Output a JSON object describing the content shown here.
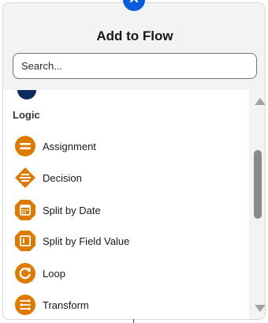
{
  "dialog": {
    "title": "Add to Flow",
    "search_placeholder": "Search...",
    "close_icon": "close-icon"
  },
  "section": {
    "label": "Logic"
  },
  "items": [
    {
      "label": "Assignment",
      "icon": "assignment-icon"
    },
    {
      "label": "Decision",
      "icon": "decision-icon"
    },
    {
      "label": "Split by Date",
      "icon": "split-by-date-icon"
    },
    {
      "label": "Split by Field Value",
      "icon": "split-by-field-value-icon"
    },
    {
      "label": "Loop",
      "icon": "loop-icon"
    },
    {
      "label": "Transform",
      "icon": "transform-icon"
    }
  ],
  "colors": {
    "accent": "#0b5cdb",
    "item_icon": "#dd7a01"
  }
}
